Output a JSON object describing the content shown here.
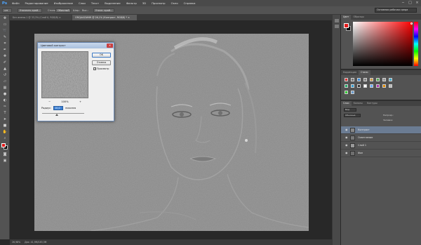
{
  "app": {
    "logo": "Ps"
  },
  "menu": [
    "Файл",
    "Редактирование",
    "Изображение",
    "Слои",
    "Текст",
    "Выделение",
    "Фильтр",
    "3D",
    "Просмотр",
    "Окно",
    "Справка"
  ],
  "window_controls": [
    "−",
    "□",
    "×"
  ],
  "options": {
    "refine_edge": "Уточнить край...",
    "style_label": "Стиль:",
    "style_value": "Обычный",
    "width_label": "Шир.:",
    "height_label": "Выс.:",
    "select_btn": "Уточн. край...",
    "workspace": "Основная рабочая среда"
  },
  "tabs": [
    {
      "label": "Без имени-1 @ 33,3% (Слой 0, RGB/8) ×",
      "active": false
    },
    {
      "label": "ORCJAAZAMW @ 26,1% (Контраст, RGB/8) * ×",
      "active": true
    }
  ],
  "status": {
    "zoom": "26,98%",
    "doc": "Док: 41,9M/183,3M"
  },
  "dialog": {
    "title": "Цветовой контраст",
    "close": "×",
    "ok": "OK",
    "cancel": "Отмена",
    "preview_label": "Просмотр",
    "preview_checked": "✓",
    "zoom_minus": "−",
    "zoom_value": "100%",
    "zoom_plus": "+",
    "radius_label": "Радиус:",
    "radius_value": "10,0",
    "radius_unit": "пикселя"
  },
  "panels": {
    "color_tabs": [
      "Цвет",
      "Образцы"
    ],
    "adj_tabs": [
      "Коррекция",
      "Стили"
    ],
    "layers_tabs": [
      "Слои",
      "Каналы",
      "Контуры"
    ],
    "kind_label": "Вид",
    "blend_mode": "Обычные",
    "opacity": "Непрозр.:",
    "fill": "Заливка:",
    "layers": [
      {
        "name": "Контраст",
        "selected": true
      },
      {
        "name": "Осветление",
        "selected": false
      },
      {
        "name": "Слой 1",
        "selected": false
      },
      {
        "name": "Фон",
        "selected": false
      }
    ]
  },
  "colors": {
    "foreground": "#e21b1b",
    "background": "#000000",
    "accent": "#3b7fd4"
  }
}
